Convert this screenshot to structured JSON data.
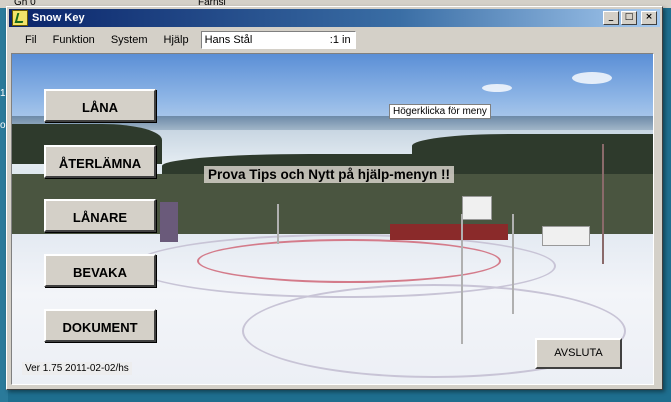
{
  "background_fragments": {
    "top_left": "Gh 0",
    "top_right": "Farnsl",
    "left_1": "1,",
    "left_2": "o"
  },
  "window": {
    "title": "Snow Key",
    "controls": {
      "minimize": "_",
      "maximize": "□",
      "close": "×"
    }
  },
  "menu": {
    "items": [
      "Fil",
      "Funktion",
      "System",
      "Hjälp"
    ],
    "user_name": "Hans Stål",
    "user_count": ":1 in"
  },
  "main": {
    "buttons": [
      "LÅNA",
      "ÅTERLÄMNA",
      "LÅNARE",
      "BEVAKA",
      "DOKUMENT"
    ],
    "hint": "Högerklicka för meny",
    "tips": "Prova Tips och Nytt på hjälp-menyn !!",
    "exit_label": "AVSLUTA",
    "version": "Ver 1.75  2011-02-02/hs"
  },
  "colors": {
    "titlebar_start": "#0a246a",
    "titlebar_end": "#a6caf0",
    "face": "#d4d0c8",
    "desktop": "#1e6e8e"
  },
  "icons": {
    "app": "snow-key-app-icon"
  }
}
